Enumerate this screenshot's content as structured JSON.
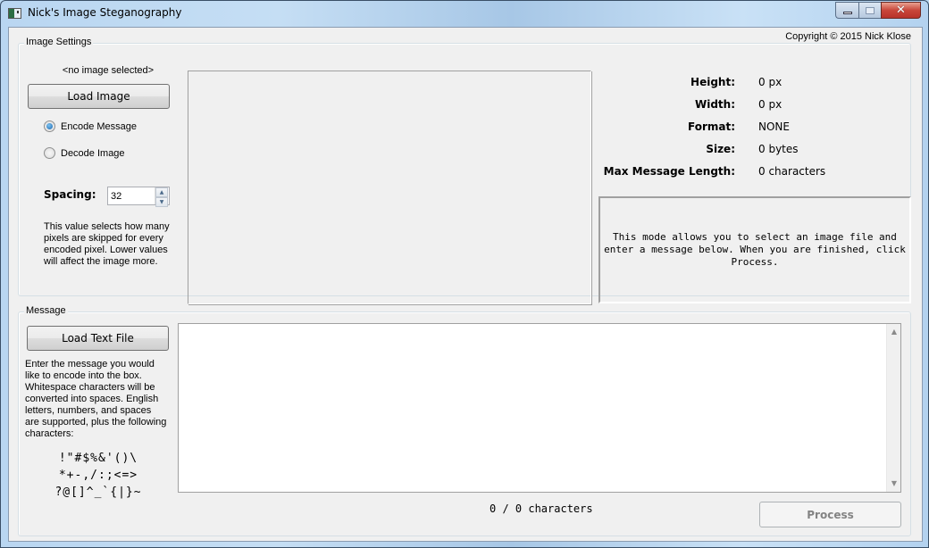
{
  "window": {
    "title": "Nick's Image Steganography",
    "icons": {
      "app": "app-icon",
      "minimize": "minimize-icon",
      "maximize": "maximize-icon",
      "close": "close-icon"
    },
    "close_glyph": "✕"
  },
  "copyright": "Copyright © 2015 Nick Klose",
  "image_settings": {
    "group_title": "Image Settings",
    "image_status": "<no image selected>",
    "load_image_label": "Load Image",
    "modes": [
      {
        "label": "Encode Message",
        "checked": true
      },
      {
        "label": "Decode Image",
        "checked": false
      }
    ],
    "spacing_label": "Spacing:",
    "spacing_value": "32",
    "spin_up": "▲",
    "spin_down": "▼",
    "spacing_help": "This value selects how many pixels are skipped for every encoded pixel. Lower values will affect the image more."
  },
  "image_info": {
    "rows": [
      {
        "label": "Height:",
        "value": "0 px"
      },
      {
        "label": "Width:",
        "value": "0 px"
      },
      {
        "label": "Format:",
        "value": "NONE"
      },
      {
        "label": "Size:",
        "value": "0 bytes"
      },
      {
        "label": "Max Message Length:",
        "value": "0 characters"
      }
    ],
    "mode_description": "This mode allows you to select an image file and enter a message below. When you are finished, click Process."
  },
  "message": {
    "group_title": "Message",
    "load_text_label": "Load Text File",
    "help_text": "Enter the message you would like to encode into the box. Whitespace characters will be converted into spaces. English letters, numbers, and spaces are supported, plus the following characters:",
    "special_chars": "!\"#$%&'()\\\n*+-,/:;<=>\n?@[]^_`{|}~",
    "text_value": "",
    "char_count": "0 / 0 characters",
    "process_label": "Process",
    "scroll_up": "▲",
    "scroll_down": "▼"
  }
}
